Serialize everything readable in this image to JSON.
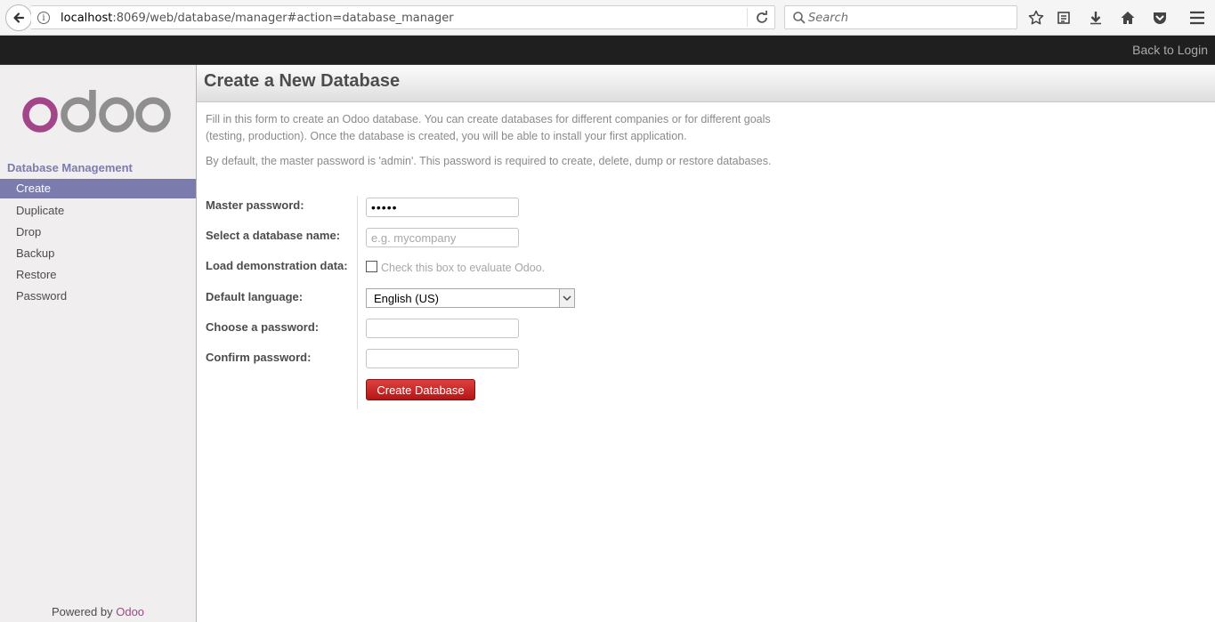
{
  "browser": {
    "url_host": "localhost",
    "url_path": ":8069/web/database/manager#action=database_manager",
    "search_placeholder": "Search"
  },
  "topbar": {
    "back_to_login": "Back to Login"
  },
  "sidebar": {
    "logo_text": "odoo",
    "section_title": "Database Management",
    "items": [
      {
        "label": "Create",
        "active": true
      },
      {
        "label": "Duplicate"
      },
      {
        "label": "Drop"
      },
      {
        "label": "Backup"
      },
      {
        "label": "Restore"
      },
      {
        "label": "Password"
      }
    ],
    "powered_by": "Powered by",
    "powered_link": "Odoo"
  },
  "main": {
    "title": "Create a New Database",
    "intro_1": "Fill in this form to create an Odoo database. You can create databases for different companies or for different goals (testing, production). Once the database is created, you will be able to install your first application.",
    "intro_2": "By default, the master password is 'admin'. This password is required to create, delete, dump or restore databases.",
    "form": {
      "master_password_label": "Master password:",
      "master_password_value": "•••••",
      "db_name_label": "Select a database name:",
      "db_name_placeholder": "e.g. mycompany",
      "demo_label": "Load demonstration data:",
      "demo_hint": "Check this box to evaluate Odoo.",
      "language_label": "Default language:",
      "language_value": "English (US)",
      "choose_password_label": "Choose a password:",
      "confirm_password_label": "Confirm password:",
      "submit_label": "Create Database"
    }
  },
  "colors": {
    "odoo_purple": "#a24689",
    "odoo_gray": "#8f8f8f",
    "accent": "#7c7bad",
    "button_red": "#c52424"
  }
}
